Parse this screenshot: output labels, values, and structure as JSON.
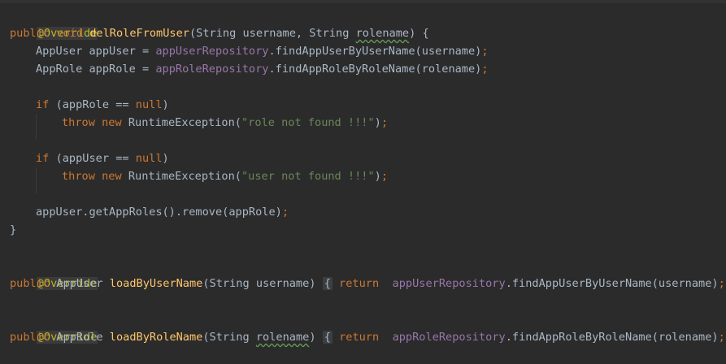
{
  "code": {
    "l1": {
      "ann": "@Override"
    },
    "l2": {
      "mod": "public void ",
      "name": "delRoleFromUser",
      "open": "(String username, String ",
      "param": "rolename",
      "close": ") {"
    },
    "l3": {
      "type": "AppUser appUser = ",
      "field": "appUserRepository",
      "call": ".findAppUserByUserName(username)",
      "semi": ";"
    },
    "l4": {
      "type": "AppRole appRole = ",
      "field": "appRoleRepository",
      "call": ".findAppRoleByRoleName(rolename)",
      "semi": ";"
    },
    "l5": {
      "kw": "if ",
      "a": "(appRole == ",
      "null": "null",
      "b": ")"
    },
    "l6": {
      "kw": "throw new ",
      "a": "RuntimeException(",
      "str": "\"role not found !!!\"",
      "b": ")",
      "semi": ";"
    },
    "l7": {
      "kw": "if ",
      "a": "(appUser == ",
      "null": "null",
      "b": ")"
    },
    "l8": {
      "kw": "throw new ",
      "a": "RuntimeException(",
      "str": "\"user not found !!!\"",
      "b": ")",
      "semi": ";"
    },
    "l9": {
      "a": "appUser.getAppRoles().remove(appRole)",
      "semi": ";"
    },
    "l10": {
      "a": "}"
    },
    "l11": {
      "ann": "@Override"
    },
    "l12": {
      "mod": "public ",
      "type": "AppUser ",
      "name": "loadByUserName",
      "a": "(String username) ",
      "ob": "{",
      "ret": " return ",
      "field": "appUserRepository",
      "call": ".findAppUserByUserName(username)",
      "semi": ";",
      "cb": "}"
    },
    "l13": {
      "ann": "@Override"
    },
    "l14": {
      "mod": "public ",
      "type": "AppRole ",
      "name": "loadByRoleName",
      "a": "(String ",
      "param": "rolename",
      "a2": ") ",
      "ob": "{",
      "ret": " return ",
      "field": "appRoleRepository",
      "call": ".findAppRoleByRoleName(rolename)",
      "semi": ";",
      "cb": "}"
    }
  }
}
